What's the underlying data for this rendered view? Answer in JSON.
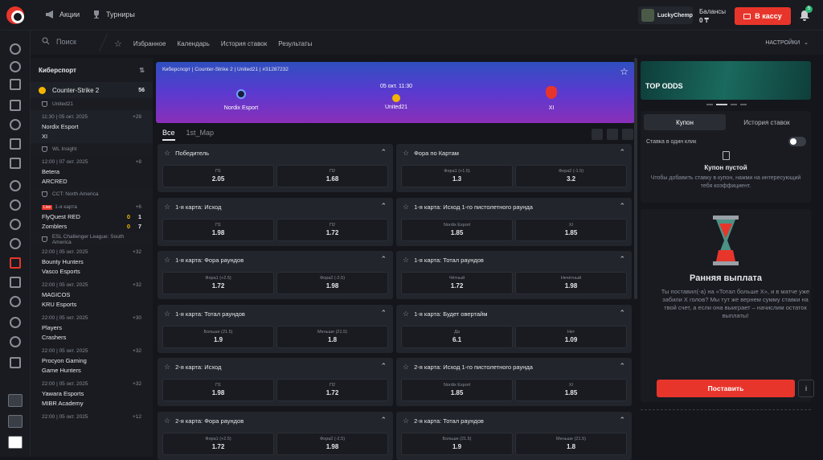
{
  "header": {
    "promo_label": "Акции",
    "tournaments_label": "Турниры",
    "username": "LuckyChemp",
    "balance_label": "Балансы",
    "balance_value": "0 ₸",
    "deposit_label": "В кассу",
    "notif_count": "5"
  },
  "subnav": {
    "search_placeholder": "Поиск",
    "items": [
      "Избранное",
      "Календарь",
      "История ставок",
      "Результаты"
    ],
    "settings_label": "НАСТРОЙКИ"
  },
  "left": {
    "title": "Киберспорт",
    "sport": "Counter-Strike 2",
    "sport_count": "56",
    "groups": [
      {
        "league": "United21",
        "matches": [
          {
            "time": "11:30 | 05 окт. 2025",
            "more": "+28",
            "t1": "Nordix Esport",
            "t2": "XI",
            "active": true
          }
        ]
      },
      {
        "league": "WL Insight",
        "matches": [
          {
            "time": "12:00 | 07 окт. 2025",
            "more": "+8",
            "t1": "Betera",
            "t2": "ARCRED"
          }
        ]
      },
      {
        "league": "CCT: North America",
        "matches": [
          {
            "time": "1-я карта",
            "live": "Live",
            "more": "+6",
            "t1": "FlyQuest RED",
            "t2": "Zomblers",
            "s1": "0",
            "s2": "0",
            "s1b": "1",
            "s2b": "7"
          }
        ]
      },
      {
        "league": "ESL Challenger League: South America",
        "matches": [
          {
            "time": "22:00 | 05 окт. 2025",
            "more": "+32",
            "t1": "Bounty Hunters",
            "t2": "Vasco Esports"
          },
          {
            "time": "22:00 | 05 окт. 2025",
            "more": "+32",
            "t1": "MAGICOS",
            "t2": "KRU Esports"
          },
          {
            "time": "22:00 | 05 окт. 2025",
            "more": "+30",
            "t1": "Players",
            "t2": "Crashers"
          },
          {
            "time": "22:00 | 05 окт. 2025",
            "more": "+32",
            "t1": "Procyon Gaming",
            "t2": "Game Hunters"
          },
          {
            "time": "22:00 | 05 окт. 2025",
            "more": "+32",
            "t1": "Yawara Esports",
            "t2": "MIBR Academy"
          },
          {
            "time": "22:00 | 05 окт. 2025",
            "more": "+12",
            "t1": "",
            "t2": ""
          }
        ]
      }
    ]
  },
  "match": {
    "breadcrumb": "Киберспорт | Counter-Strike 2 | United21 | #31287232",
    "date": "05 окт. 11:30",
    "league": "United21",
    "team1": "Nordix Esport",
    "team2": "XI"
  },
  "tabs": [
    "Все",
    "1st_Map"
  ],
  "markets": [
    {
      "title": "Победитель",
      "o": [
        [
          "П1",
          "2.05"
        ],
        [
          "П2",
          "1.68"
        ]
      ]
    },
    {
      "title": "Фора по Картам",
      "o": [
        [
          "Фора1 (+1.5)",
          "1.3"
        ],
        [
          "Фора2 (-1.5)",
          "3.2"
        ]
      ]
    },
    {
      "title": "1-я карта: Исход",
      "o": [
        [
          "П1",
          "1.98"
        ],
        [
          "П2",
          "1.72"
        ]
      ]
    },
    {
      "title": "1-я карта: Исход 1-го пистолетного раунда",
      "o": [
        [
          "Nordix Esport",
          "1.85"
        ],
        [
          "XI",
          "1.85"
        ]
      ]
    },
    {
      "title": "1-я карта: Фора раундов",
      "o": [
        [
          "Фора1 (+2.5)",
          "1.72"
        ],
        [
          "Фора2 (-2.5)",
          "1.98"
        ]
      ]
    },
    {
      "title": "1-я карта: Тотал раундов",
      "o": [
        [
          "Чётный",
          "1.72"
        ],
        [
          "Нечётный",
          "1.98"
        ]
      ]
    },
    {
      "title": "1-я карта: Тотал раундов",
      "o": [
        [
          "Больше (21.5)",
          "1.9"
        ],
        [
          "Меньше (21.5)",
          "1.8"
        ]
      ]
    },
    {
      "title": "1-я карта: Будет овертайм",
      "o": [
        [
          "Да",
          "6.1"
        ],
        [
          "Нет",
          "1.09"
        ]
      ]
    },
    {
      "title": "2-я карта: Исход",
      "o": [
        [
          "П1",
          "1.98"
        ],
        [
          "П2",
          "1.72"
        ]
      ]
    },
    {
      "title": "2-я карта: Исход 1-го пистолетного раунда",
      "o": [
        [
          "Nordix Esport",
          "1.85"
        ],
        [
          "XI",
          "1.85"
        ]
      ]
    },
    {
      "title": "2-я карта: Фора раундов",
      "o": [
        [
          "Фора1 (+2.5)",
          "1.72"
        ],
        [
          "Фора2 (-2.5)",
          "1.98"
        ]
      ]
    },
    {
      "title": "2-я карта: Тотал раундов",
      "o": [
        [
          "Больше (21.5)",
          "1.9"
        ],
        [
          "Меньше (21.5)",
          "1.8"
        ]
      ]
    }
  ],
  "right": {
    "promo_title": "TOP ODDS",
    "coupon_tab": "Купон",
    "history_tab": "История ставок",
    "one_click": "Ставка в один клик",
    "empty_title": "Купон пустой",
    "empty_desc": "Чтобы добавить ставку в купон, нажми на интересующий тебя коэффициент.",
    "early_title": "Ранняя выплата",
    "early_desc": "Ты поставил(-а) на «Тотал больше Х», и в матче уже забили Х голов? Мы тут же вернем сумму ставки на твой счет, а если она выиграет – начислим остаток выплаты!",
    "place_label": "Поставить"
  },
  "colors": {
    "accent": "#e8352b",
    "bg": "#14161b",
    "panel": "#191b21",
    "card": "#22252b"
  }
}
